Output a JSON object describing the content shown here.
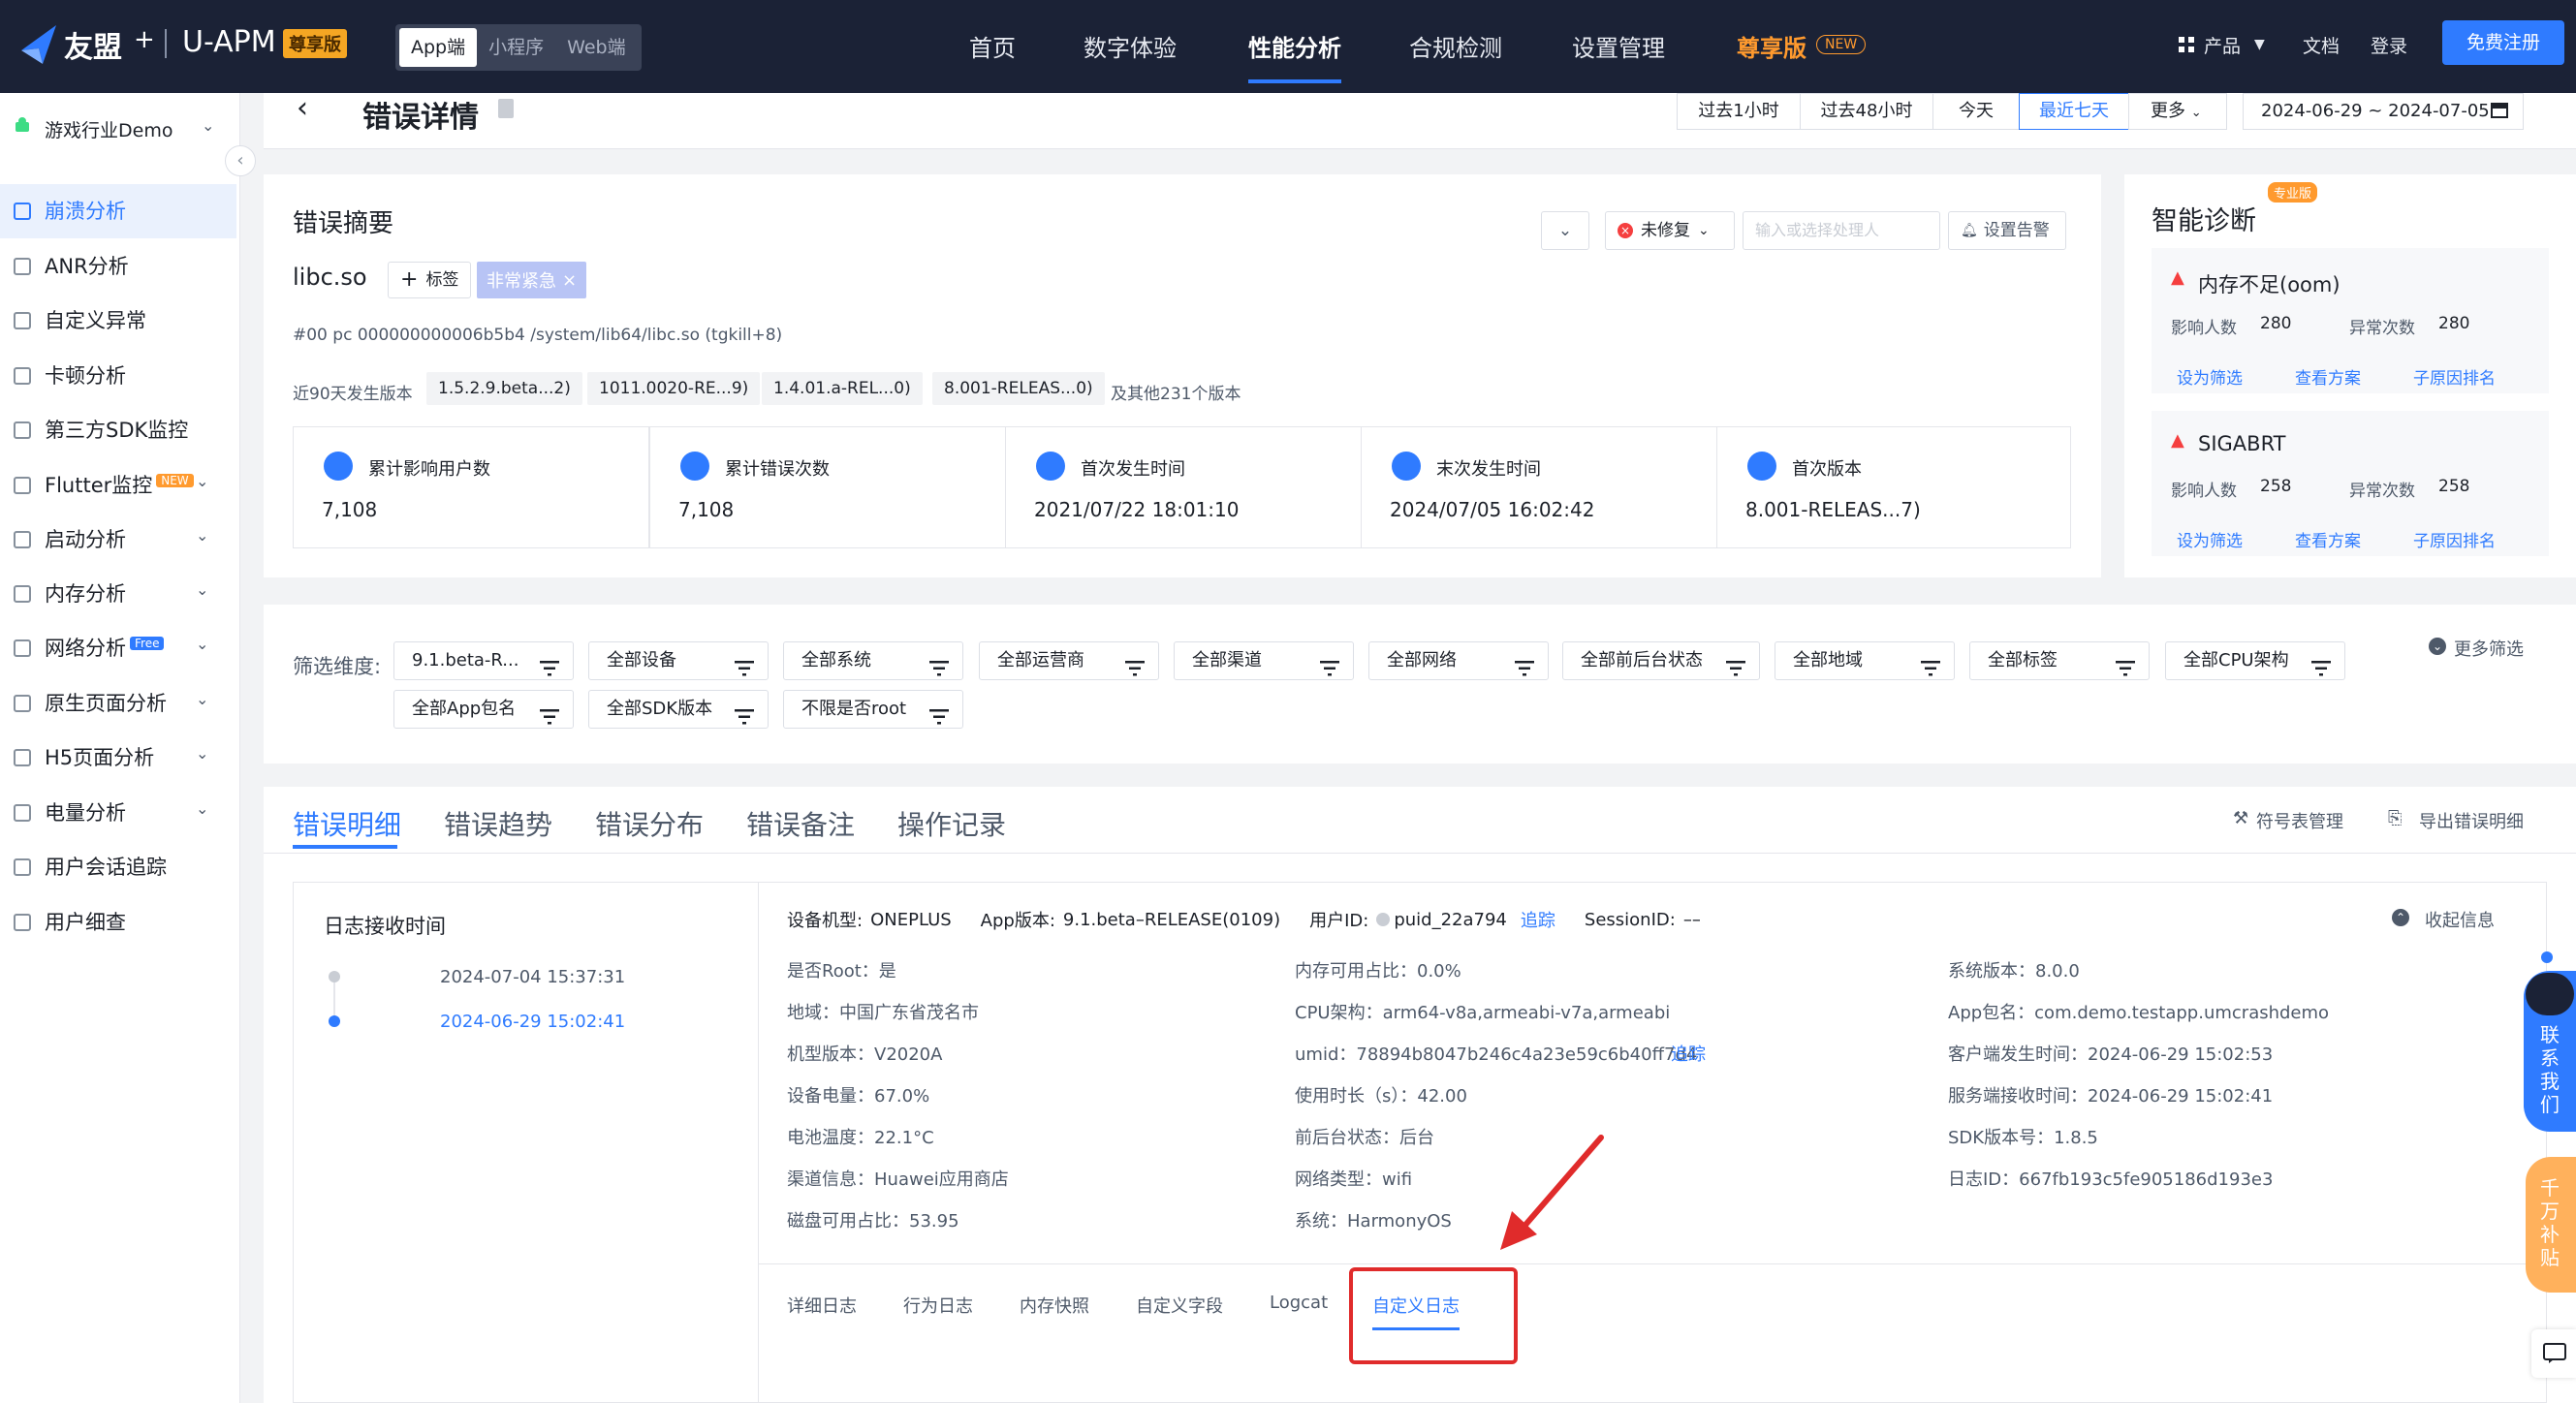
{
  "topnav": {
    "brand": "友盟",
    "plus": "+",
    "product": "U-APM",
    "edition_badge": "尊享版",
    "platforms": [
      "App端",
      "小程序",
      "Web端"
    ],
    "menu": [
      "首页",
      "数字体验",
      "性能分析",
      "合规检测",
      "设置管理"
    ],
    "vip": "尊享版",
    "vip_badge": "NEW",
    "product_menu": "产品",
    "docs": "文档",
    "login": "登录",
    "register": "免费注册",
    "accent": "#2f7bff"
  },
  "sidebar": {
    "app_name": "游戏行业Demo",
    "items": [
      {
        "label": "崩溃分析"
      },
      {
        "label": "ANR分析"
      },
      {
        "label": "自定义异常"
      },
      {
        "label": "卡顿分析"
      },
      {
        "label": "第三方SDK监控"
      },
      {
        "label": "Flutter监控",
        "badge": "NEW"
      },
      {
        "label": "启动分析"
      },
      {
        "label": "内存分析"
      },
      {
        "label": "网络分析",
        "badge": "Free"
      },
      {
        "label": "原生页面分析"
      },
      {
        "label": "H5页面分析"
      },
      {
        "label": "电量分析"
      },
      {
        "label": "用户会话追踪"
      },
      {
        "label": "用户细查"
      }
    ]
  },
  "page": {
    "title": "错误详情",
    "time_ranges": [
      "过去1小时",
      "过去48小时",
      "今天",
      "最近七天",
      "更多"
    ],
    "date_range": "2024-06-29 ~ 2024-07-05"
  },
  "summary": {
    "title": "错误摘要",
    "status": "未修复",
    "assignee_placeholder": "输入或选择处理人",
    "alert": "设置告警",
    "lib": "libc.so",
    "tag_btn": "标签",
    "tag": "非常紧急",
    "stack": "#00 pc 000000000006b5b4 /system/lib64/libc.so (tgkill+8)",
    "versions_label": "近90天发生版本",
    "versions": [
      "1.5.2.9.beta...2)",
      "1011.0020-RE...9)",
      "1.4.01.a-REL...0)",
      "8.001-RELEAS...0)"
    ],
    "versions_more": "及其他231个版本",
    "stats": [
      {
        "label": "累计影响用户数",
        "value": "7,108"
      },
      {
        "label": "累计错误次数",
        "value": "7,108"
      },
      {
        "label": "首次发生时间",
        "value": "2021/07/22 18:01:10"
      },
      {
        "label": "末次发生时间",
        "value": "2024/07/05 16:02:42"
      },
      {
        "label": "首次版本",
        "value": "8.001-RELEAS...7)"
      }
    ]
  },
  "diagnosis": {
    "title": "智能诊断",
    "badge": "专业版",
    "items": [
      {
        "name": "内存不足(oom)",
        "users_label": "影响人数",
        "users": "280",
        "count_label": "异常次数",
        "count": "280",
        "links": [
          "设为筛选",
          "查看方案",
          "子原因排名"
        ]
      },
      {
        "name": "SIGABRT",
        "users_label": "影响人数",
        "users": "258",
        "count_label": "异常次数",
        "count": "258",
        "links": [
          "设为筛选",
          "查看方案",
          "子原因排名"
        ]
      }
    ]
  },
  "filters": {
    "label": "筛选维度:",
    "row1": [
      "9.1.beta-R...",
      "全部设备",
      "全部系统",
      "全部运营商",
      "全部渠道",
      "全部网络",
      "全部前后台状态",
      "全部地域",
      "全部标签",
      "全部CPU架构"
    ],
    "row2": [
      "全部App包名",
      "全部SDK版本",
      "不限是否root"
    ],
    "more": "更多筛选"
  },
  "detail": {
    "tabs": [
      "错误明细",
      "错误趋势",
      "错误分布",
      "错误备注",
      "操作记录"
    ],
    "symbol_mgmt": "符号表管理",
    "export": "导出错误明细",
    "log_time_title": "日志接收时间",
    "log_times": [
      "2024-07-04 15:37:31",
      "2024-06-29 15:02:41"
    ],
    "header": {
      "model_k": "设备机型:",
      "model_v": "ONEPLUS",
      "appver_k": "App版本:",
      "appver_v": "9.1.beta–RELEASE(0109)",
      "uid_k": "用户ID:",
      "uid_v": "puid_22a794",
      "trace": "追踪",
      "session_k": "SessionID:",
      "session_v": "––",
      "collapse": "收起信息"
    },
    "col1": [
      "是否Root：是",
      "地域：中国广东省茂名市",
      "机型版本：V2020A",
      "设备电量：67.0%",
      "电池温度：22.1°C",
      "渠道信息：Huawei应用商店",
      "磁盘可用占比：53.95"
    ],
    "col2": [
      "内存可用占比：0.0%",
      "CPU架构：arm64-v8a,armeabi-v7a,armeabi",
      "umid：78894b8047b246c4a23e59c6b40ff7d4",
      "使用时长（s）：42.00",
      "前后台状态：后台",
      "网络类型：wifi",
      "系统：HarmonyOS"
    ],
    "col2_trace": "追踪",
    "col3": [
      "系统版本：8.0.0",
      "App包名：com.demo.testapp.umcrashdemo",
      "客户端发生时间：2024-06-29 15:02:53",
      "服务端接收时间：2024-06-29 15:02:41",
      "SDK版本号：1.8.5",
      "日志ID：667fb193c5fe905186d193e3"
    ],
    "subtabs": [
      "详细日志",
      "行为日志",
      "内存快照",
      "自定义字段",
      "Logcat",
      "自定义日志"
    ]
  },
  "float": {
    "contact": [
      "联",
      "系",
      "我",
      "们"
    ],
    "subsidy": [
      "千",
      "万",
      "补",
      "贴"
    ]
  }
}
